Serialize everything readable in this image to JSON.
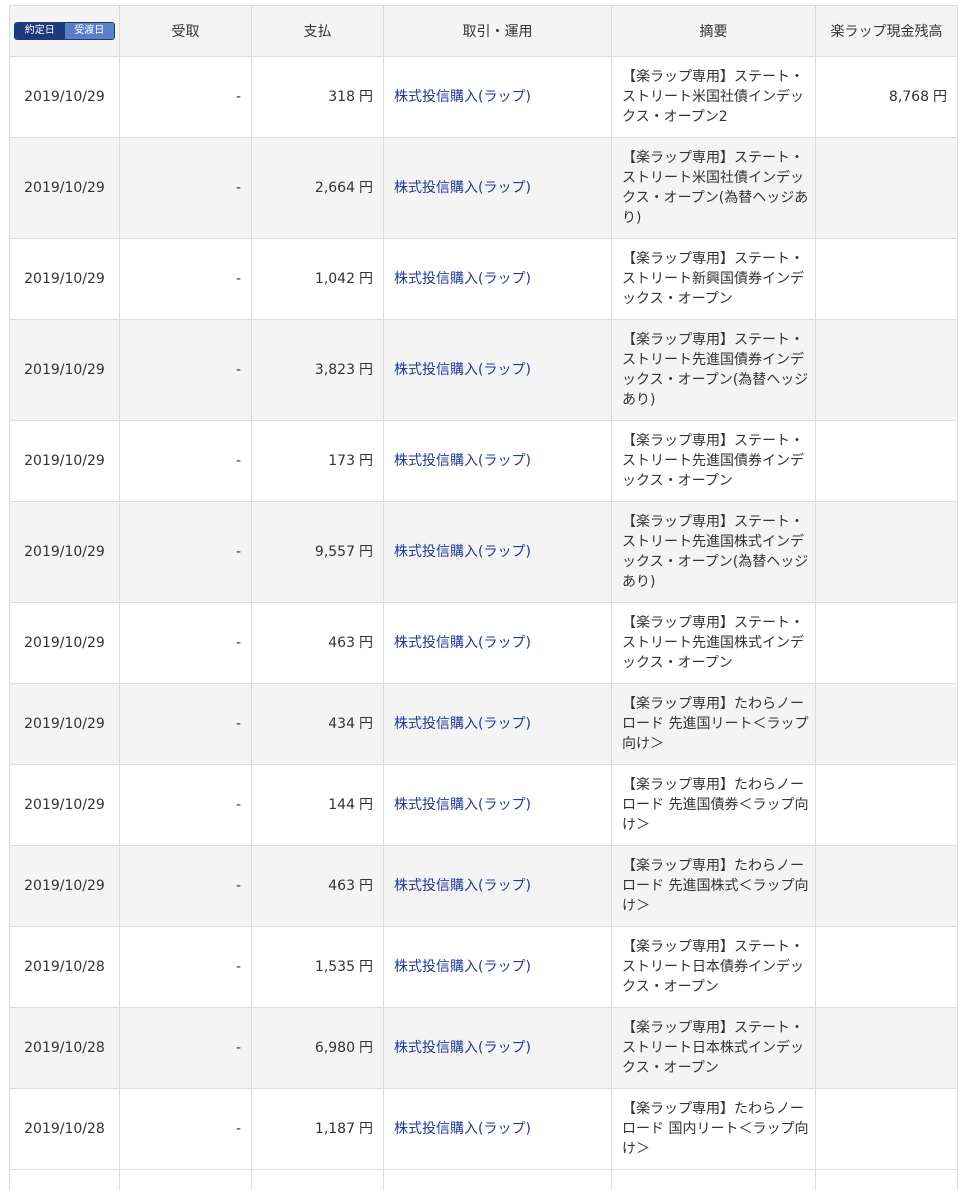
{
  "header": {
    "toggle": {
      "trade_date": "約定日",
      "settle_date": "受渡日"
    },
    "receive": "受取",
    "payment": "支払",
    "transaction": "取引・運用",
    "summary": "摘要",
    "balance": "楽ラップ現金残高"
  },
  "rows": [
    {
      "date": "2019/10/29",
      "receive": "-",
      "payment": "318",
      "unit": "円",
      "type": "株式投信購入(ラップ)",
      "summary": "【楽ラップ専用】ステート・ストリート米国社債インデックス・オープン2",
      "balance": "8,768",
      "balance_unit": "円"
    },
    {
      "date": "2019/10/29",
      "receive": "-",
      "payment": "2,664",
      "unit": "円",
      "type": "株式投信購入(ラップ)",
      "summary": "【楽ラップ専用】ステート・ストリート米国社債インデックス・オープン(為替ヘッジあり)",
      "balance": "",
      "balance_unit": ""
    },
    {
      "date": "2019/10/29",
      "receive": "-",
      "payment": "1,042",
      "unit": "円",
      "type": "株式投信購入(ラップ)",
      "summary": "【楽ラップ専用】ステート・ストリート新興国債券インデックス・オープン",
      "balance": "",
      "balance_unit": ""
    },
    {
      "date": "2019/10/29",
      "receive": "-",
      "payment": "3,823",
      "unit": "円",
      "type": "株式投信購入(ラップ)",
      "summary": "【楽ラップ専用】ステート・ストリート先進国債券インデックス・オープン(為替ヘッジあり)",
      "balance": "",
      "balance_unit": ""
    },
    {
      "date": "2019/10/29",
      "receive": "-",
      "payment": "173",
      "unit": "円",
      "type": "株式投信購入(ラップ)",
      "summary": "【楽ラップ専用】ステート・ストリート先進国債券インデックス・オープン",
      "balance": "",
      "balance_unit": ""
    },
    {
      "date": "2019/10/29",
      "receive": "-",
      "payment": "9,557",
      "unit": "円",
      "type": "株式投信購入(ラップ)",
      "summary": "【楽ラップ専用】ステート・ストリート先進国株式インデックス・オープン(為替ヘッジあり)",
      "balance": "",
      "balance_unit": ""
    },
    {
      "date": "2019/10/29",
      "receive": "-",
      "payment": "463",
      "unit": "円",
      "type": "株式投信購入(ラップ)",
      "summary": "【楽ラップ専用】ステート・ストリート先進国株式インデックス・オープン",
      "balance": "",
      "balance_unit": ""
    },
    {
      "date": "2019/10/29",
      "receive": "-",
      "payment": "434",
      "unit": "円",
      "type": "株式投信購入(ラップ)",
      "summary": "【楽ラップ専用】たわらノーロード 先進国リート＜ラップ向け＞",
      "balance": "",
      "balance_unit": ""
    },
    {
      "date": "2019/10/29",
      "receive": "-",
      "payment": "144",
      "unit": "円",
      "type": "株式投信購入(ラップ)",
      "summary": "【楽ラップ専用】たわらノーロード 先進国債券＜ラップ向け＞",
      "balance": "",
      "balance_unit": ""
    },
    {
      "date": "2019/10/29",
      "receive": "-",
      "payment": "463",
      "unit": "円",
      "type": "株式投信購入(ラップ)",
      "summary": "【楽ラップ専用】たわらノーロード 先進国株式＜ラップ向け＞",
      "balance": "",
      "balance_unit": ""
    },
    {
      "date": "2019/10/28",
      "receive": "-",
      "payment": "1,535",
      "unit": "円",
      "type": "株式投信購入(ラップ)",
      "summary": "【楽ラップ専用】ステート・ストリート日本債券インデックス・オープン",
      "balance": "",
      "balance_unit": ""
    },
    {
      "date": "2019/10/28",
      "receive": "-",
      "payment": "6,980",
      "unit": "円",
      "type": "株式投信購入(ラップ)",
      "summary": "【楽ラップ専用】ステート・ストリート日本株式インデックス・オープン",
      "balance": "",
      "balance_unit": ""
    },
    {
      "date": "2019/10/28",
      "receive": "-",
      "payment": "1,187",
      "unit": "円",
      "type": "株式投信購入(ラップ)",
      "summary": "【楽ラップ専用】たわらノーロード 国内リート＜ラップ向け＞",
      "balance": "",
      "balance_unit": ""
    }
  ]
}
